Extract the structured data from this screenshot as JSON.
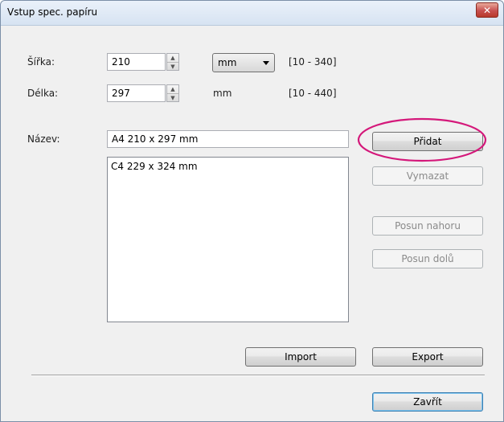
{
  "window": {
    "title": "Vstup spec. papíru",
    "close_glyph": "✕"
  },
  "width": {
    "label": "Šířka:",
    "value": "210",
    "unit": "mm",
    "range": "[10 - 340]"
  },
  "length": {
    "label": "Délka:",
    "value": "297",
    "unit": "mm",
    "range": "[10 - 440]"
  },
  "name": {
    "label": "Název:",
    "value": "A4 210 x 297 mm"
  },
  "list": {
    "items": [
      "C4 229 x 324 mm"
    ]
  },
  "buttons": {
    "add": "Přidat",
    "delete": "Vymazat",
    "move_up": "Posun nahoru",
    "move_down": "Posun dolů",
    "import": "Import",
    "export": "Export",
    "close": "Zavřít"
  },
  "colors": {
    "highlight": "#d4187a",
    "close_button": "#c75050"
  }
}
